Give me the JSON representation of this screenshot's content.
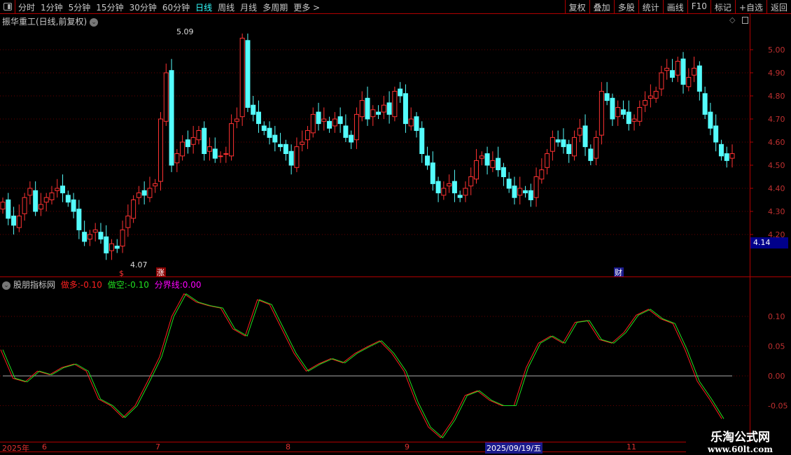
{
  "toolbar": {
    "periods": [
      "分时",
      "1分钟",
      "5分钟",
      "15分钟",
      "30分钟",
      "60分钟",
      "日线",
      "周线",
      "月线",
      "多周期",
      "更多 >"
    ],
    "active": 6,
    "right": [
      "复权",
      "叠加",
      "多股",
      "统计",
      "画线",
      "F10",
      "标记",
      "+自选",
      "返回"
    ]
  },
  "title": "振华重工(日线,前复权)",
  "price_axis": {
    "ticks": [
      "5.00",
      "4.90",
      "4.80",
      "4.70",
      "4.60",
      "4.50",
      "4.40",
      "4.30",
      "4.20"
    ],
    "current": "4.14"
  },
  "annotations": {
    "high": "5.09",
    "low": "4.07",
    "zhang": "涨",
    "dollar": "$",
    "cai": "财"
  },
  "indicator": {
    "name": "股朋指标网",
    "long_label": "做多:",
    "long_value": "-0.10",
    "short_label": "做空:",
    "short_value": "-0.10",
    "bound_label": "分界线:",
    "bound_value": "0.00",
    "ticks": [
      "0.10",
      "0.05",
      "0.00",
      "-0.05"
    ]
  },
  "dates": {
    "year": "2025年",
    "months": [
      "6",
      "7",
      "8",
      "9",
      "11"
    ],
    "selected": "2025/09/19/五"
  },
  "watermark": {
    "name": "乐淘公式网",
    "url": "www.60lt.com"
  },
  "colors": {
    "up": "#ff3232",
    "down": "#54fcfc",
    "long": "#ff2020",
    "short": "#20e020"
  },
  "chart_data": {
    "type": "candlestick",
    "ylim": [
      4.0,
      5.12
    ],
    "closes": [
      4.34,
      4.27,
      4.24,
      4.28,
      4.36,
      4.4,
      4.3,
      4.33,
      4.36,
      4.38,
      4.4,
      4.38,
      4.34,
      4.3,
      4.22,
      4.17,
      4.2,
      4.22,
      4.18,
      4.12,
      4.16,
      4.14,
      4.22,
      4.28,
      4.35,
      4.38,
      4.37,
      4.4,
      4.42,
      4.7,
      4.9,
      4.5,
      4.55,
      4.6,
      4.58,
      4.62,
      4.65,
      4.55,
      4.58,
      4.53,
      4.54,
      4.55,
      4.68,
      4.7,
      5.05,
      4.75,
      4.72,
      4.68,
      4.65,
      4.62,
      4.6,
      4.58,
      4.55,
      4.5,
      4.58,
      4.6,
      4.65,
      4.72,
      4.68,
      4.7,
      4.66,
      4.7,
      4.68,
      4.62,
      4.6,
      4.72,
      4.78,
      4.7,
      4.74,
      4.72,
      4.76,
      4.72,
      4.82,
      4.8,
      4.68,
      4.7,
      4.65,
      4.55,
      4.5,
      4.42,
      4.38,
      4.4,
      4.42,
      4.38,
      4.36,
      4.4,
      4.45,
      4.52,
      4.54,
      4.5,
      4.52,
      4.48,
      4.45,
      4.4,
      4.36,
      4.4,
      4.38,
      4.35,
      4.45,
      4.48,
      4.55,
      4.62,
      4.6,
      4.58,
      4.55,
      4.62,
      4.66,
      4.58,
      4.52,
      4.62,
      4.82,
      4.78,
      4.7,
      4.75,
      4.72,
      4.68,
      4.7,
      4.75,
      4.78,
      4.8,
      4.82,
      4.9,
      4.92,
      4.88,
      4.95,
      4.85,
      4.88,
      4.92,
      4.82,
      4.72,
      4.66,
      4.6,
      4.54,
      4.52,
      4.55
    ],
    "indicator_series": [
      0.044,
      -0.004,
      -0.01,
      0.008,
      0.002,
      0.014,
      0.02,
      0.008,
      -0.039,
      -0.05,
      -0.07,
      -0.05,
      -0.01,
      0.032,
      0.1,
      0.138,
      0.124,
      0.118,
      0.114,
      0.079,
      0.067,
      0.128,
      0.12,
      0.079,
      0.038,
      0.008,
      0.02,
      0.029,
      0.022,
      0.038,
      0.049,
      0.059,
      0.038,
      0.008,
      -0.045,
      -0.086,
      -0.104,
      -0.074,
      -0.033,
      -0.025,
      -0.041,
      -0.05,
      -0.05,
      0.014,
      0.055,
      0.067,
      0.055,
      0.09,
      0.093,
      0.061,
      0.055,
      0.073,
      0.102,
      0.112,
      0.096,
      0.088,
      0.044,
      -0.009,
      -0.039,
      -0.072
    ],
    "indicator_ylim": [
      -0.11,
      0.16
    ]
  }
}
